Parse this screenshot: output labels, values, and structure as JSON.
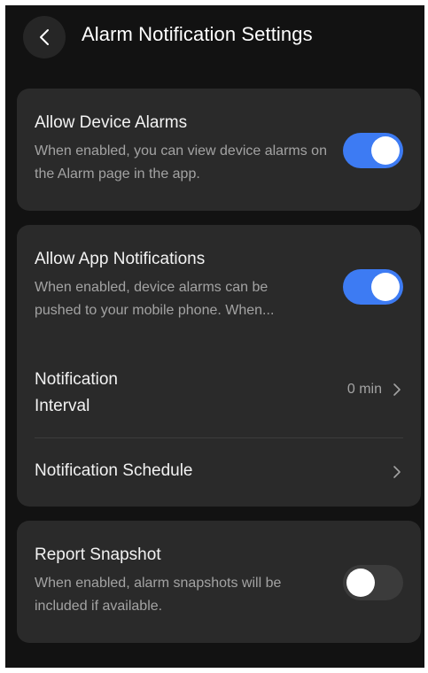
{
  "header": {
    "title": "Alarm Notification Settings",
    "back_icon": "chevron-left-icon"
  },
  "device_alarms": {
    "title": "Allow Device Alarms",
    "description": "When enabled, you can view device alarms on the Alarm page in the app.",
    "enabled": true
  },
  "app_notifications": {
    "title": "Allow App Notifications",
    "description_line1": "When enabled, device alarms can be",
    "description_line2": "pushed to your mobile phone. When...",
    "enabled": true,
    "interval": {
      "label": "Notification Interval",
      "value": "0 min"
    },
    "schedule": {
      "label": "Notification Schedule"
    }
  },
  "report_snapshot": {
    "title": "Report Snapshot",
    "description": "When enabled, alarm snapshots will be included if available.",
    "enabled": false
  },
  "colors": {
    "background": "#121212",
    "card": "#2a2a2a",
    "accent": "#3d7bf3",
    "primary_text": "#f2f2f2",
    "secondary_text": "#a3a3a3"
  }
}
